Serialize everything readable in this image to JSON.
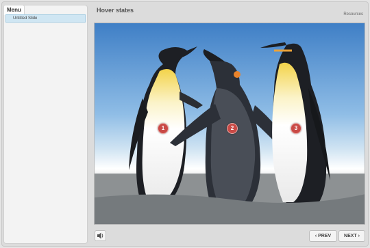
{
  "sidebar": {
    "tab_label": "Menu",
    "items": [
      {
        "label": "Untitled Slide"
      }
    ]
  },
  "slide": {
    "title": "Hover states",
    "resources_label": "Resources",
    "hotspots": [
      {
        "label": "1"
      },
      {
        "label": "2"
      },
      {
        "label": "3"
      }
    ]
  },
  "controls": {
    "volume_icon": "speaker-icon",
    "prev_label": "PREV",
    "next_label": "NEXT",
    "prev_arrow": "‹",
    "next_arrow": "›"
  },
  "colors": {
    "hotspot": "#c94a46",
    "menu_item_selected": "#cfe6f3"
  }
}
